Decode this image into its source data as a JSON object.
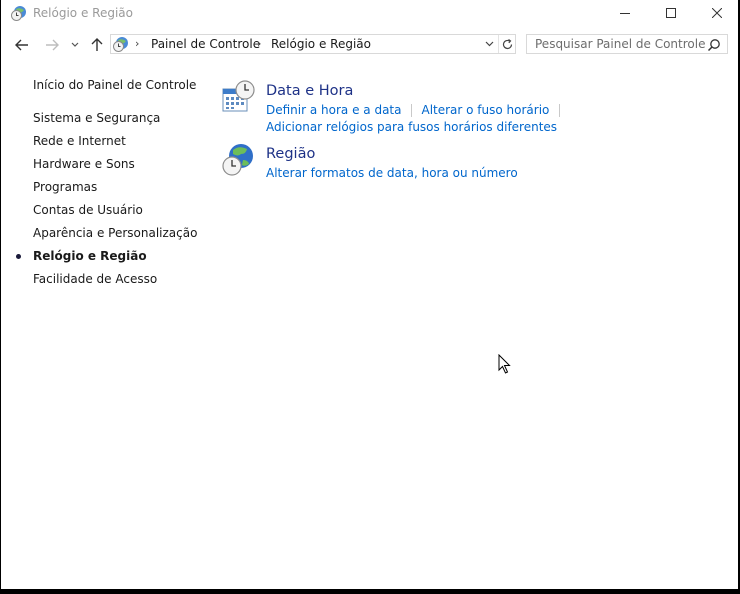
{
  "window": {
    "title": "Relógio e Região",
    "controls": {
      "minimize": "minimize-icon",
      "maximize": "maximize-icon",
      "close": "close-icon"
    }
  },
  "nav": {
    "back_icon": "arrow-left-icon",
    "forward_icon": "arrow-right-icon",
    "recent_icon": "chevron-down-icon",
    "up_icon": "arrow-up-icon",
    "breadcrumb": [
      "Painel de Controle",
      "Relógio e Região"
    ],
    "refresh_icon": "refresh-icon"
  },
  "search": {
    "placeholder": "Pesquisar Painel de Controle",
    "value": ""
  },
  "sidebar": {
    "home": "Início do Painel de Controle",
    "items": [
      {
        "label": "Sistema e Segurança",
        "active": false
      },
      {
        "label": "Rede e Internet",
        "active": false
      },
      {
        "label": "Hardware e Sons",
        "active": false
      },
      {
        "label": "Programas",
        "active": false
      },
      {
        "label": "Contas de Usuário",
        "active": false
      },
      {
        "label": "Aparência e Personalização",
        "active": false
      },
      {
        "label": "Relógio e Região",
        "active": true
      },
      {
        "label": "Facilidade de Acesso",
        "active": false
      }
    ]
  },
  "main": {
    "categories": [
      {
        "title": "Data e Hora",
        "icon": "calendar-clock-icon",
        "links": [
          "Definir a hora e a data",
          "Alterar o fuso horário",
          "Adicionar relógios para fusos horários diferentes"
        ]
      },
      {
        "title": "Região",
        "icon": "globe-clock-icon",
        "links": [
          "Alterar formatos de data, hora ou número"
        ]
      }
    ]
  },
  "colors": {
    "link": "#0066cc",
    "category_title": "#1e3287",
    "text": "#1a1a1a",
    "title_text": "#9a9a9a"
  }
}
